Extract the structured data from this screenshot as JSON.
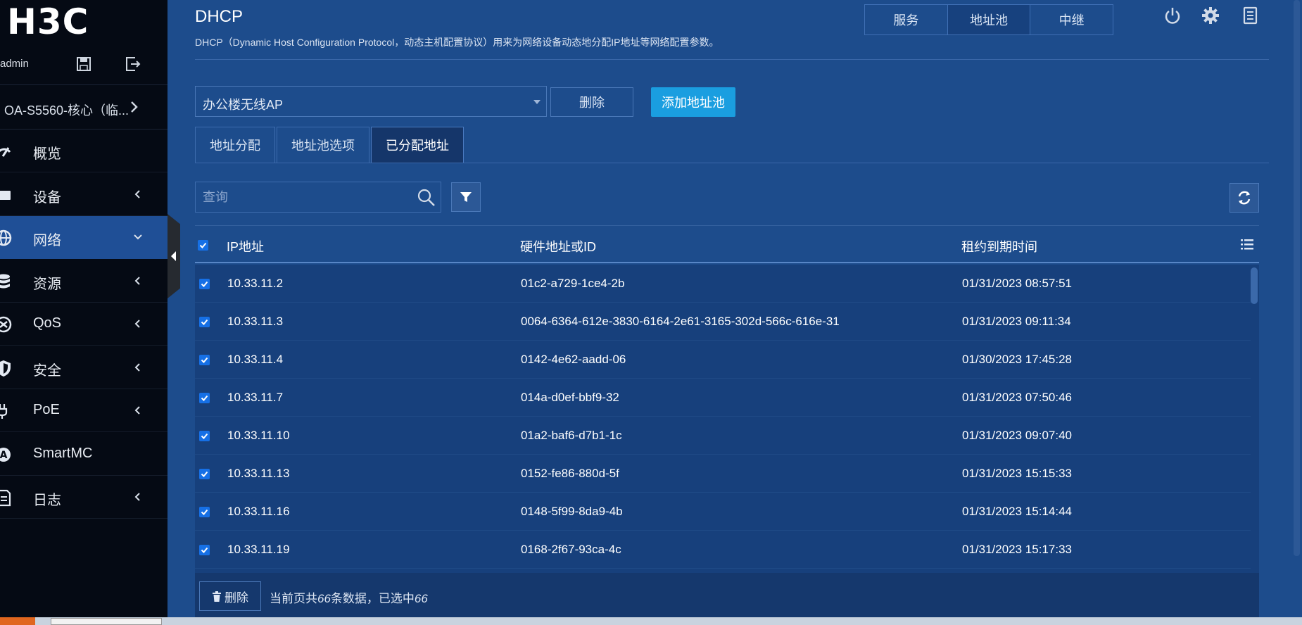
{
  "sidebar": {
    "logo": "H3C",
    "username": "admin",
    "device_name": "OA-S5560-核心（临...",
    "items": [
      {
        "label": "概览",
        "icon": "dashboard-icon",
        "arrow": ""
      },
      {
        "label": "设备",
        "icon": "device-icon",
        "arrow": "left"
      },
      {
        "label": "网络",
        "icon": "globe-icon",
        "arrow": "down"
      },
      {
        "label": "资源",
        "icon": "database-icon",
        "arrow": "left"
      },
      {
        "label": "QoS",
        "icon": "qos-icon",
        "arrow": "left"
      },
      {
        "label": "安全",
        "icon": "shield-icon",
        "arrow": "left"
      },
      {
        "label": "PoE",
        "icon": "poe-icon",
        "arrow": "left"
      },
      {
        "label": "SmartMC",
        "icon": "smartmc-icon",
        "arrow": ""
      },
      {
        "label": "日志",
        "icon": "log-icon",
        "arrow": "left"
      }
    ],
    "active_index": 2
  },
  "header": {
    "title": "DHCP",
    "description": "DHCP（Dynamic Host Configuration Protocol，动态主机配置协议）用来为网络设备动态地分配IP地址等网络配置参数。",
    "tabs": [
      "服务",
      "地址池",
      "中继"
    ],
    "active_tab": 1
  },
  "pool": {
    "selected": "办公楼无线AP",
    "delete_label": "删除",
    "add_label": "添加地址池"
  },
  "subtabs": {
    "items": [
      "地址分配",
      "地址池选项",
      "已分配地址"
    ],
    "active": 2
  },
  "search": {
    "placeholder": "查询",
    "value": ""
  },
  "table": {
    "headers": {
      "ip": "IP地址",
      "mac": "硬件地址或ID",
      "lease": "租约到期时间"
    },
    "rows": [
      {
        "ip": "10.33.11.2",
        "mac": "01c2-a729-1ce4-2b",
        "lease": "01/31/2023 08:57:51",
        "checked": true
      },
      {
        "ip": "10.33.11.3",
        "mac": "0064-6364-612e-3830-6164-2e61-3165-302d-566c-616e-31",
        "lease": "01/31/2023 09:11:34",
        "checked": true
      },
      {
        "ip": "10.33.11.4",
        "mac": "0142-4e62-aadd-06",
        "lease": "01/30/2023 17:45:28",
        "checked": true
      },
      {
        "ip": "10.33.11.7",
        "mac": "014a-d0ef-bbf9-32",
        "lease": "01/31/2023 07:50:46",
        "checked": true
      },
      {
        "ip": "10.33.11.10",
        "mac": "01a2-baf6-d7b1-1c",
        "lease": "01/31/2023 09:07:40",
        "checked": true
      },
      {
        "ip": "10.33.11.13",
        "mac": "0152-fe86-880d-5f",
        "lease": "01/31/2023 15:15:33",
        "checked": true
      },
      {
        "ip": "10.33.11.16",
        "mac": "0148-5f99-8da9-4b",
        "lease": "01/31/2023 15:14:44",
        "checked": true
      },
      {
        "ip": "10.33.11.19",
        "mac": "0168-2f67-93ca-4c",
        "lease": "01/31/2023 15:17:33",
        "checked": true
      }
    ]
  },
  "footer": {
    "delete_label": "删除",
    "status_prefix": "当前页共",
    "total": "66",
    "status_middle": "条数据，已选中",
    "selected": "66"
  },
  "colors": {
    "background": "#1d4c8c",
    "sidebar": "#050a14",
    "accent": "#1a9ee0",
    "checkbox": "#1670e6"
  }
}
